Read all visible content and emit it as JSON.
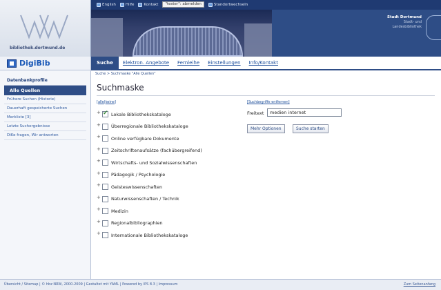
{
  "header": {
    "logo_text": "bibliothek.dortmund.de",
    "topbar": {
      "items": [
        {
          "label": "English",
          "icon": "flag-icon"
        },
        {
          "label": "Hilfe",
          "icon": "help-icon"
        },
        {
          "label": "Kontakt",
          "icon": "contact-icon"
        }
      ],
      "user_button": "\"tester\": abmelden",
      "location_link": "Standortwechseln"
    },
    "city": {
      "title": "Stadt Dortmund",
      "line1": "Stadt- und",
      "line2": "Landesbibliothek"
    }
  },
  "brand": {
    "name": "DigiBib"
  },
  "nav": {
    "tabs": [
      {
        "label": "Suche"
      },
      {
        "label": "Elektron. Angebote"
      },
      {
        "label": "Fernleihe"
      },
      {
        "label": "Einstellungen"
      },
      {
        "label": "Info/Kontakt"
      }
    ]
  },
  "breadcrumb": "Suche > Suchmaske \"Alle Quellen\"",
  "sidebar": {
    "heading": "Datenbankprofile",
    "active": "Alle Quellen",
    "items": [
      {
        "label": "Frühere Suchen (Historie)"
      },
      {
        "label": "Dauerhaft gespeicherte Suchen"
      },
      {
        "label": "Merkliste [3]"
      },
      {
        "label": "Letzte Suchergebnisse"
      },
      {
        "label": "DiKe fragen, Wir antworten"
      }
    ]
  },
  "main": {
    "title": "Suchmaske",
    "select_all": "alle",
    "select_none": "keine",
    "categories": [
      {
        "label": "Lokale Bibliothekskataloge",
        "checked": true
      },
      {
        "label": "Überregionale Bibliothekskataloge",
        "checked": false
      },
      {
        "label": "Online verfügbare Dokumente",
        "checked": false
      },
      {
        "label": "Zeitschriftenaufsätze (fachübergreifend)",
        "checked": false
      },
      {
        "label": "Wirtschafts- und Sozialwissenschaften",
        "checked": false
      },
      {
        "label": "Pädagogik / Psychologie",
        "checked": false
      },
      {
        "label": "Geisteswissenschaften",
        "checked": false
      },
      {
        "label": "Naturwissenschaften / Technik",
        "checked": false
      },
      {
        "label": "Medizin",
        "checked": false
      },
      {
        "label": "Regionalbibliographien",
        "checked": false
      },
      {
        "label": "Internationale Bibliothekskataloge",
        "checked": false
      }
    ],
    "remove_terms": "Suchbegriffe entfernen",
    "freitext_label": "Freitext",
    "freitext_value": "medien internet",
    "more_options": "Mehr Optionen",
    "start_search": "Suche starten"
  },
  "footer": {
    "text": "Übersicht / Sitemap | © hbz NRW, 2000-2009 | Gestaltet mit YAML | Powered by IPS 8.3 | Impressum",
    "right_link": "Zum Seitenanfang"
  }
}
